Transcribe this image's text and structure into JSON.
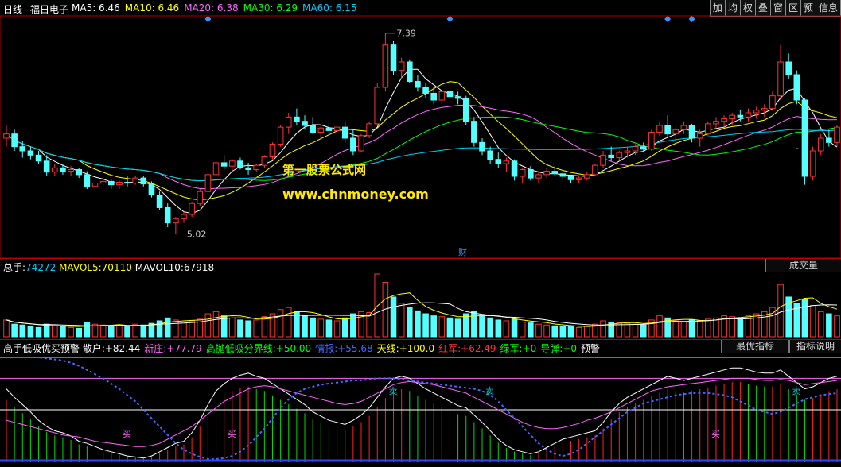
{
  "header": {
    "period": "日线",
    "stock_name": "福日电子",
    "ma": [
      {
        "label": "MA5:",
        "value": "6.46",
        "color": "#ffffff"
      },
      {
        "label": "MA10:",
        "value": "6.46",
        "color": "#ffff00"
      },
      {
        "label": "MA20:",
        "value": "6.38",
        "color": "#ff66ff"
      },
      {
        "label": "MA30:",
        "value": "6.29",
        "color": "#00ff00"
      },
      {
        "label": "MA60:",
        "value": "6.15",
        "color": "#00ccff"
      }
    ],
    "tools": [
      "加",
      "均",
      "权",
      "叠",
      "窗",
      "区",
      "预",
      "信息"
    ]
  },
  "watermark": {
    "line1": "第一股票公式网",
    "line2": "www.chnmoney.com"
  },
  "price_panel": {
    "high_label": "7.39",
    "low_label": "5.02",
    "fin_marker": "财",
    "dash_marker": "-"
  },
  "volume_panel": {
    "total_label": "总手:",
    "total_value": "74272",
    "mavol5_label": "MAVOL5:",
    "mavol5_value": "70110",
    "mavol10_label": "MAVOL10:",
    "mavol10_value": "67918",
    "tab": "成交量"
  },
  "indicator_panel": {
    "title": "高手低吸优买预警",
    "items": [
      {
        "label": "散户:",
        "value": "+82.44",
        "color": "#ffffff"
      },
      {
        "label": "新庄:",
        "value": "+77.79",
        "color": "#ff66ff"
      },
      {
        "label": "高抛低吸分界线:",
        "value": "+50.00",
        "color": "#00ff00"
      },
      {
        "label": "情报:",
        "value": "+55.68",
        "color": "#4466ff"
      },
      {
        "label": "天线:",
        "value": "+100.0",
        "color": "#ffff00"
      },
      {
        "label": "红军:",
        "value": "+62.49",
        "color": "#ff3333"
      },
      {
        "label": "绿军:",
        "value": "+0",
        "color": "#00ff00"
      },
      {
        "label": "导弹:",
        "value": "+0",
        "color": "#00ff00"
      },
      {
        "label": "预警",
        "value": "",
        "color": "#ffffff"
      }
    ],
    "tab1": "最优指标",
    "tab2": "指标说明",
    "buy_label": "买",
    "sell_label": "卖"
  },
  "colors": {
    "up": "#ff3232",
    "down": "#54ffff",
    "border": "#b00000"
  },
  "chart_data": [
    {
      "type": "candlestick",
      "title": "福日电子 日线",
      "ylim": [
        4.8,
        7.5
      ],
      "bars": [
        [
          6.15,
          6.3,
          6.05,
          6.2
        ],
        [
          6.2,
          6.25,
          6.0,
          6.05
        ],
        [
          6.05,
          6.12,
          5.92,
          6.0
        ],
        [
          6.0,
          6.05,
          5.9,
          5.95
        ],
        [
          5.95,
          6.0,
          5.85,
          5.88
        ],
        [
          5.88,
          5.95,
          5.7,
          5.75
        ],
        [
          5.75,
          5.85,
          5.7,
          5.8
        ],
        [
          5.8,
          5.85,
          5.72,
          5.76
        ],
        [
          5.76,
          5.82,
          5.7,
          5.78
        ],
        [
          5.78,
          5.8,
          5.68,
          5.72
        ],
        [
          5.72,
          5.76,
          5.55,
          5.58
        ],
        [
          5.58,
          5.65,
          5.5,
          5.62
        ],
        [
          5.62,
          5.68,
          5.58,
          5.64
        ],
        [
          5.64,
          5.66,
          5.55,
          5.6
        ],
        [
          5.6,
          5.65,
          5.55,
          5.63
        ],
        [
          5.63,
          5.7,
          5.58,
          5.62
        ],
        [
          5.62,
          5.7,
          5.6,
          5.68
        ],
        [
          5.68,
          5.7,
          5.58,
          5.61
        ],
        [
          5.61,
          5.64,
          5.45,
          5.48
        ],
        [
          5.48,
          5.52,
          5.3,
          5.33
        ],
        [
          5.33,
          5.38,
          5.1,
          5.15
        ],
        [
          5.15,
          5.22,
          5.02,
          5.2
        ],
        [
          5.2,
          5.28,
          5.15,
          5.25
        ],
        [
          5.25,
          5.4,
          5.22,
          5.38
        ],
        [
          5.38,
          5.55,
          5.35,
          5.52
        ],
        [
          5.52,
          5.75,
          5.5,
          5.72
        ],
        [
          5.72,
          5.9,
          5.7,
          5.86
        ],
        [
          5.86,
          5.95,
          5.78,
          5.82
        ],
        [
          5.82,
          5.9,
          5.75,
          5.88
        ],
        [
          5.88,
          5.92,
          5.78,
          5.8
        ],
        [
          5.8,
          5.86,
          5.72,
          5.78
        ],
        [
          5.78,
          5.85,
          5.75,
          5.83
        ],
        [
          5.83,
          5.95,
          5.8,
          5.93
        ],
        [
          5.93,
          6.1,
          5.9,
          6.08
        ],
        [
          6.08,
          6.3,
          6.05,
          6.28
        ],
        [
          6.28,
          6.45,
          6.2,
          6.4
        ],
        [
          6.4,
          6.5,
          6.3,
          6.35
        ],
        [
          6.35,
          6.42,
          6.25,
          6.3
        ],
        [
          6.3,
          6.4,
          6.2,
          6.22
        ],
        [
          6.22,
          6.3,
          6.15,
          6.27
        ],
        [
          6.27,
          6.35,
          6.2,
          6.24
        ],
        [
          6.24,
          6.3,
          6.18,
          6.28
        ],
        [
          6.28,
          6.35,
          6.1,
          6.15
        ],
        [
          6.15,
          6.25,
          5.95,
          6.0
        ],
        [
          6.0,
          6.2,
          5.98,
          6.18
        ],
        [
          6.18,
          6.35,
          6.15,
          6.32
        ],
        [
          6.32,
          6.8,
          6.3,
          6.75
        ],
        [
          6.75,
          7.39,
          6.7,
          7.25
        ],
        [
          7.25,
          7.3,
          6.9,
          6.95
        ],
        [
          6.95,
          7.1,
          6.85,
          7.05
        ],
        [
          7.05,
          7.08,
          6.8,
          6.82
        ],
        [
          6.82,
          6.9,
          6.7,
          6.75
        ],
        [
          6.75,
          6.8,
          6.62,
          6.68
        ],
        [
          6.68,
          6.75,
          6.55,
          6.6
        ],
        [
          6.6,
          6.72,
          6.55,
          6.7
        ],
        [
          6.7,
          6.78,
          6.6,
          6.64
        ],
        [
          6.64,
          6.7,
          6.55,
          6.62
        ],
        [
          6.62,
          6.65,
          6.3,
          6.35
        ],
        [
          6.35,
          6.4,
          6.05,
          6.1
        ],
        [
          6.1,
          6.15,
          5.95,
          6.0
        ],
        [
          6.0,
          6.05,
          5.85,
          5.9
        ],
        [
          5.9,
          5.98,
          5.8,
          5.85
        ],
        [
          5.85,
          5.92,
          5.75,
          5.88
        ],
        [
          5.88,
          5.9,
          5.65,
          5.7
        ],
        [
          5.7,
          5.8,
          5.62,
          5.78
        ],
        [
          5.78,
          5.82,
          5.65,
          5.68
        ],
        [
          5.68,
          5.75,
          5.62,
          5.72
        ],
        [
          5.72,
          5.8,
          5.68,
          5.76
        ],
        [
          5.76,
          5.82,
          5.7,
          5.73
        ],
        [
          5.73,
          5.76,
          5.65,
          5.7
        ],
        [
          5.7,
          5.72,
          5.62,
          5.66
        ],
        [
          5.66,
          5.7,
          5.62,
          5.68
        ],
        [
          5.68,
          5.75,
          5.65,
          5.72
        ],
        [
          5.72,
          5.85,
          5.7,
          5.83
        ],
        [
          5.83,
          6.0,
          5.8,
          5.95
        ],
        [
          5.95,
          6.05,
          5.88,
          5.92
        ],
        [
          5.92,
          6.0,
          5.88,
          5.98
        ],
        [
          5.98,
          6.05,
          5.92,
          6.0
        ],
        [
          6.0,
          6.08,
          5.95,
          6.05
        ],
        [
          6.05,
          6.1,
          5.98,
          6.02
        ],
        [
          6.02,
          6.25,
          6.0,
          6.22
        ],
        [
          6.22,
          6.35,
          6.18,
          6.3
        ],
        [
          6.3,
          6.42,
          6.15,
          6.2
        ],
        [
          6.2,
          6.28,
          6.12,
          6.25
        ],
        [
          6.25,
          6.35,
          6.2,
          6.3
        ],
        [
          6.3,
          6.32,
          6.1,
          6.15
        ],
        [
          6.15,
          6.25,
          6.05,
          6.2
        ],
        [
          6.2,
          6.35,
          6.18,
          6.32
        ],
        [
          6.32,
          6.4,
          6.25,
          6.35
        ],
        [
          6.35,
          6.42,
          6.28,
          6.38
        ],
        [
          6.38,
          6.45,
          6.3,
          6.42
        ],
        [
          6.42,
          6.48,
          6.35,
          6.4
        ],
        [
          6.4,
          6.5,
          6.35,
          6.45
        ],
        [
          6.45,
          6.52,
          6.38,
          6.48
        ],
        [
          6.48,
          6.55,
          6.4,
          6.5
        ],
        [
          6.5,
          6.7,
          6.48,
          6.65
        ],
        [
          6.65,
          7.25,
          6.6,
          7.05
        ],
        [
          7.05,
          7.15,
          6.85,
          6.9
        ],
        [
          6.9,
          6.95,
          6.55,
          6.6
        ],
        [
          6.6,
          6.62,
          5.6,
          5.7
        ],
        [
          5.7,
          6.05,
          5.65,
          6.0
        ],
        [
          6.0,
          6.2,
          5.95,
          6.15
        ],
        [
          6.15,
          6.25,
          6.05,
          6.1
        ],
        [
          6.1,
          6.3,
          6.05,
          6.28
        ]
      ]
    },
    {
      "type": "bar",
      "title": "成交量",
      "series_name": "总手",
      "values": [
        40,
        30,
        28,
        25,
        22,
        30,
        26,
        24,
        22,
        20,
        35,
        30,
        28,
        25,
        27,
        26,
        30,
        28,
        32,
        38,
        45,
        40,
        35,
        38,
        42,
        55,
        60,
        50,
        45,
        40,
        38,
        40,
        48,
        55,
        65,
        70,
        60,
        50,
        45,
        42,
        40,
        38,
        45,
        55,
        60,
        58,
        150,
        130,
        95,
        80,
        70,
        62,
        55,
        50,
        48,
        45,
        42,
        55,
        60,
        50,
        45,
        40,
        38,
        42,
        35,
        33,
        30,
        28,
        26,
        25,
        24,
        22,
        25,
        30,
        38,
        35,
        33,
        32,
        30,
        28,
        40,
        50,
        45,
        38,
        35,
        40,
        38,
        42,
        45,
        50,
        48,
        45,
        50,
        55,
        60,
        70,
        125,
        95,
        80,
        90,
        75,
        60,
        55,
        50
      ],
      "mavol5": 70110,
      "mavol10": 67918
    },
    {
      "type": "line",
      "title": "高手低吸优买预警",
      "ylim": [
        0,
        100
      ],
      "series": [
        {
          "name": "散户",
          "color": "#ffffff",
          "values": [
            70,
            62,
            55,
            48,
            40,
            34,
            30,
            28,
            25,
            20,
            18,
            15,
            12,
            10,
            8,
            6,
            5,
            4,
            6,
            10,
            14,
            18,
            20,
            28,
            40,
            55,
            68,
            75,
            80,
            83,
            85,
            82,
            80,
            75,
            70,
            65,
            60,
            55,
            48,
            44,
            40,
            38,
            36,
            40,
            45,
            52,
            62,
            72,
            80,
            82,
            80,
            75,
            70,
            66,
            62,
            58,
            54,
            52,
            45,
            38,
            30,
            22,
            16,
            12,
            10,
            8,
            10,
            14,
            18,
            22,
            24,
            26,
            28,
            30,
            38,
            48,
            56,
            62,
            66,
            70,
            74,
            78,
            82,
            80,
            78,
            80,
            82,
            84,
            86,
            88,
            90,
            90,
            88,
            86,
            85,
            85,
            88,
            82,
            76,
            70,
            72,
            76,
            80,
            82
          ]
        },
        {
          "name": "新庄",
          "color": "#ff66ff",
          "values": [
            40,
            38,
            36,
            34,
            32,
            30,
            28,
            26,
            25,
            24,
            22,
            20,
            19,
            18,
            17,
            16,
            15,
            15,
            16,
            18,
            22,
            26,
            30,
            34,
            40,
            46,
            52,
            58,
            62,
            66,
            70,
            72,
            73,
            72,
            70,
            68,
            66,
            64,
            62,
            60,
            58,
            56,
            55,
            56,
            58,
            62,
            66,
            70,
            74,
            76,
            77,
            76,
            75,
            74,
            72,
            70,
            68,
            66,
            62,
            58,
            54,
            50,
            46,
            42,
            38,
            35,
            33,
            32,
            32,
            33,
            35,
            37,
            40,
            42,
            45,
            48,
            52,
            56,
            60,
            64,
            68,
            70,
            72,
            73,
            74,
            75,
            76,
            77,
            78,
            79,
            80,
            80,
            80,
            79,
            78,
            78,
            79,
            78,
            76,
            74,
            75,
            76,
            77,
            78
          ]
        },
        {
          "name": "情报",
          "color": "#4466ff",
          "values": [
            100,
            100,
            100,
            100,
            100,
            99,
            98,
            97,
            95,
            92,
            88,
            84,
            80,
            75,
            70,
            64,
            58,
            50,
            42,
            34,
            26,
            18,
            12,
            8,
            5,
            3,
            3,
            4,
            6,
            10,
            16,
            24,
            32,
            42,
            52,
            60,
            66,
            70,
            72,
            74,
            75,
            76,
            77,
            78,
            78,
            79,
            80,
            80,
            80,
            79,
            78,
            77,
            76,
            75,
            74,
            73,
            72,
            71,
            70,
            68,
            64,
            58,
            50,
            42,
            34,
            26,
            18,
            12,
            8,
            6,
            8,
            12,
            18,
            24,
            30,
            36,
            42,
            48,
            52,
            56,
            58,
            60,
            62,
            64,
            65,
            66,
            66,
            66,
            65,
            64,
            62,
            58,
            54,
            50,
            48,
            46,
            48,
            52,
            56,
            60,
            62,
            64,
            65,
            66
          ]
        }
      ]
    }
  ]
}
